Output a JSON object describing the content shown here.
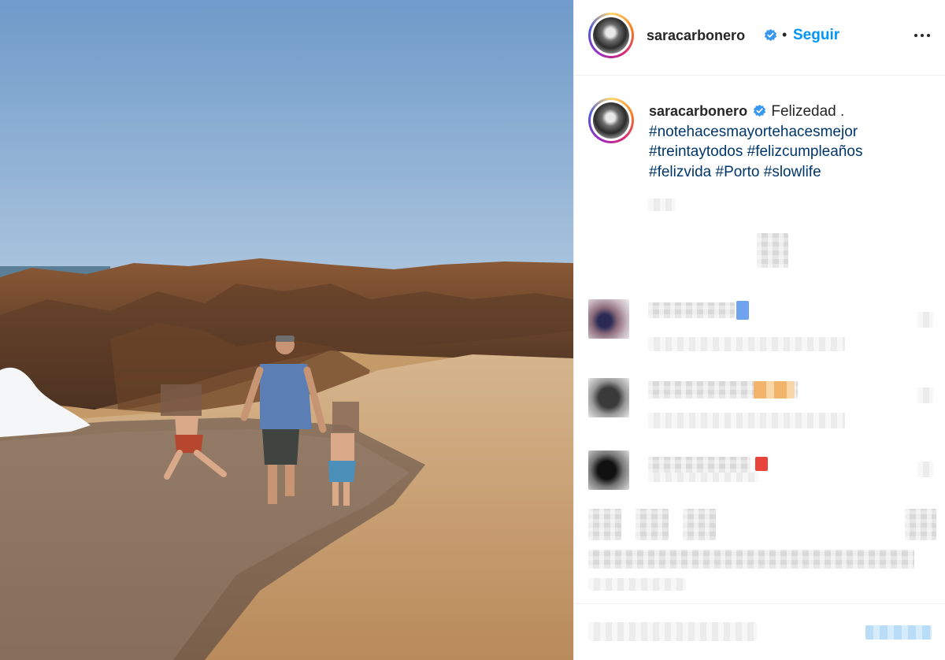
{
  "post": {
    "username": "saracarbonero",
    "follow_label": "Seguir",
    "caption_text": "Felizedad .",
    "hashtags": [
      "#notehacesmayortehacesmejor",
      "#treintaytodos",
      "#felizcumpleaños",
      "#felizvida",
      "#Porto",
      "#slowlife"
    ]
  },
  "icons": {
    "verified": "verified-badge-icon",
    "more": "more-options-icon"
  },
  "colors": {
    "follow_blue": "#0095f6",
    "hashtag": "#00376b",
    "verified_blue": "#3897f0"
  }
}
